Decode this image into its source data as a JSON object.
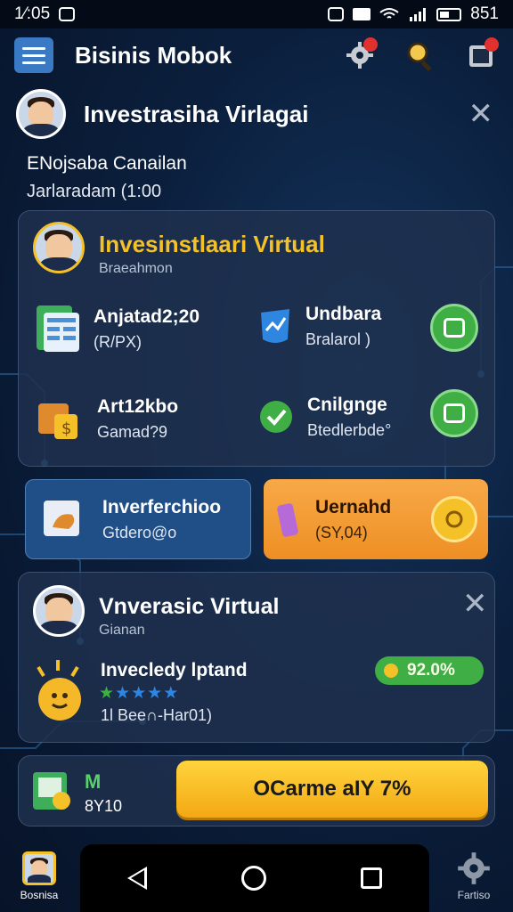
{
  "status_bar": {
    "time": "1⁄:05",
    "right_time": "851"
  },
  "header": {
    "title": "Bisinis Mobok"
  },
  "banner": {
    "title": "Investrasiha Virlagai"
  },
  "info": {
    "line1": "ENojsaba Canailan",
    "line2": "Jarlaradam (1:00"
  },
  "card_main": {
    "title": "Invesinstlaari Virtual",
    "subtitle": "Braeahmon",
    "items": [
      {
        "title": "Anjatad2;20",
        "sub": "(R/PX)",
        "icon": "spreadsheet-icon"
      },
      {
        "title": "Undbara",
        "sub": "Bralarol )",
        "icon": "chart-shield-icon"
      },
      {
        "title": "Art12kbo",
        "sub": "Gamad?9",
        "icon": "shopping-bag-icon"
      },
      {
        "title": "Cnilgnge",
        "sub": "Btedlerbde°",
        "icon": "check-chat-icon"
      }
    ],
    "accent_color": "#f5c129",
    "action_color": "#3fae45"
  },
  "tiles": [
    {
      "title": "Inverferchioo",
      "sub": "Gtdero@o",
      "color": "#1f4f86",
      "icon": "document-icon"
    },
    {
      "title": "Uernahd",
      "sub": "(SY,04)",
      "color": "#f29a2e",
      "icon": "candy-icon"
    }
  ],
  "card_second": {
    "title": "Vnverasic Virtual",
    "subtitle": "Gianan",
    "item_title": "Invecledy lptand",
    "item_sub": "1l Bee∩-Har01)",
    "rating": 4.5,
    "badge": "92.0%",
    "icon": "coin-mascot-icon"
  },
  "bottom_card": {
    "letter": "M",
    "value": "8Y10",
    "cta": "OCarme aIY 7%"
  },
  "bottom_nav": {
    "left_label": "Bosnisa",
    "right_label": "Fartiso"
  }
}
